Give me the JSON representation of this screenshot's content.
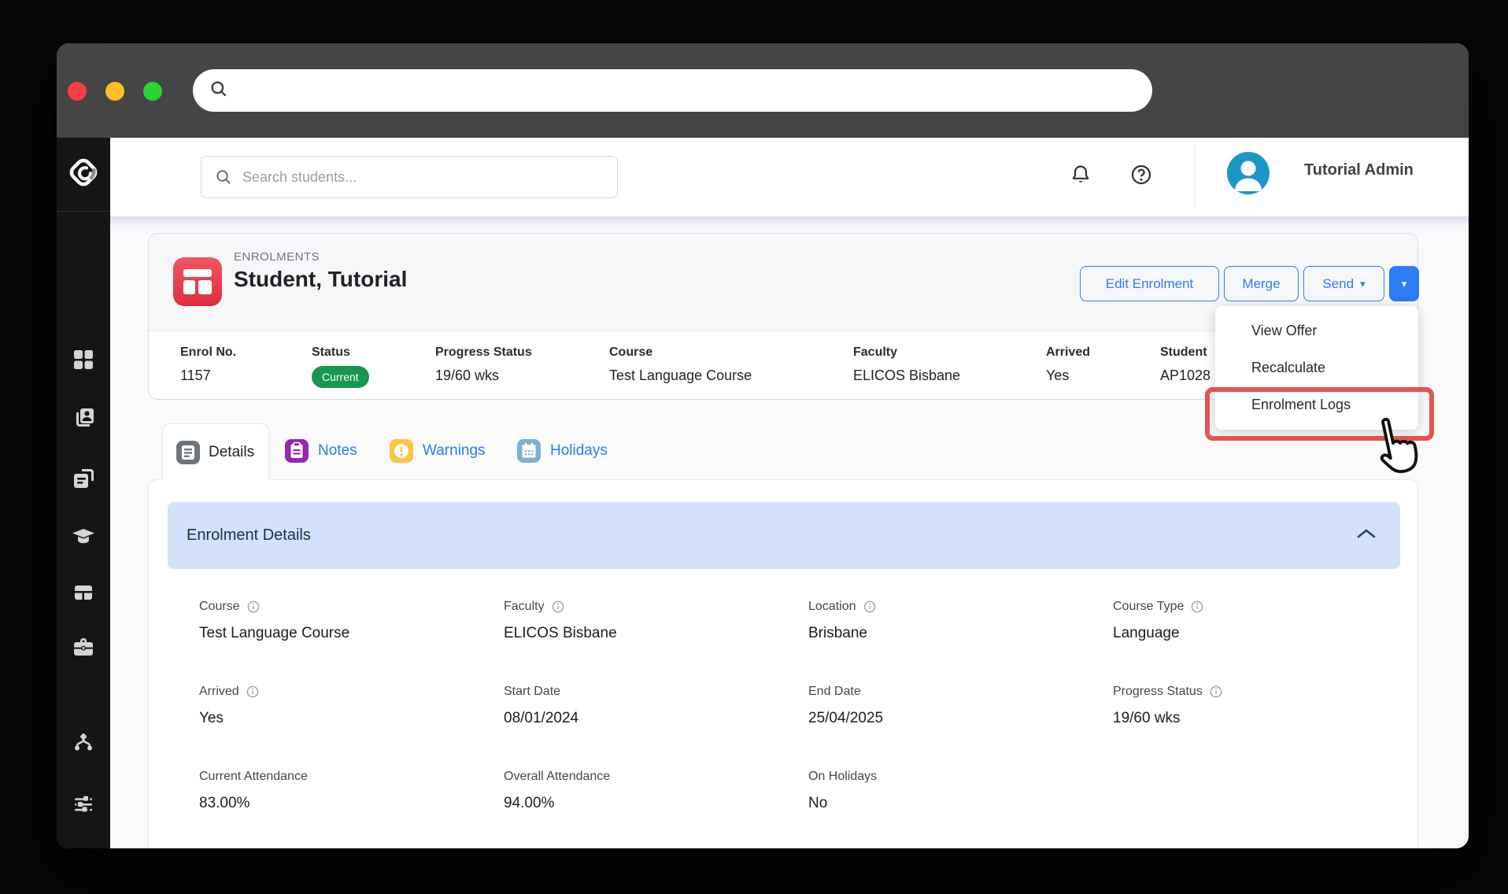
{
  "colors": {
    "accent_blue": "#2e7cf6",
    "status_green": "#16964e",
    "annotation_red": "#e4544e",
    "avatar_blue": "#1d96c5",
    "panel_header_blue": "#d3e2fa",
    "enrolments_icon_red": "#dd2e3f",
    "notes_icon_purple": "#9129b4",
    "warnings_icon_yellow": "#f8c73d",
    "holidays_icon_blue": "#7fb0d4",
    "details_icon_gray": "#6d757b"
  },
  "topbar": {
    "search_placeholder": "Search students...",
    "user_name": "Tutorial Admin",
    "icons": [
      "bell-icon",
      "help-icon",
      "avatar"
    ]
  },
  "sidebar": {
    "icons": [
      "dashboard",
      "contacts",
      "documents",
      "courses",
      "tables",
      "briefcase",
      "workflow",
      "settings"
    ]
  },
  "header": {
    "eyebrow": "ENROLMENTS",
    "title": "Student, Tutorial",
    "buttons": {
      "edit": "Edit Enrolment",
      "merge": "Merge",
      "send": "Send"
    }
  },
  "summary": {
    "columns": [
      {
        "label": "Enrol No.",
        "value": "1157"
      },
      {
        "label": "Status",
        "value": "Current",
        "type": "badge"
      },
      {
        "label": "Progress Status",
        "value": "19/60 wks"
      },
      {
        "label": "Course",
        "value": "Test Language Course"
      },
      {
        "label": "Faculty",
        "value": "ELICOS Bisbane"
      },
      {
        "label": "Arrived",
        "value": "Yes"
      },
      {
        "label": "Student",
        "value": "AP1028",
        "type": "link"
      }
    ]
  },
  "menu": {
    "items": [
      {
        "label": "View Offer"
      },
      {
        "label": "Recalculate"
      },
      {
        "label": "Enrolment Logs",
        "highlighted": true
      }
    ]
  },
  "tabs": [
    {
      "label": "Details",
      "active": true
    },
    {
      "label": "Notes"
    },
    {
      "label": "Warnings"
    },
    {
      "label": "Holidays"
    }
  ],
  "panel": {
    "title": "Enrolment Details",
    "fields": [
      {
        "label": "Course",
        "value": "Test Language Course",
        "info": true
      },
      {
        "label": "Faculty",
        "value": "ELICOS Bisbane",
        "info": true
      },
      {
        "label": "Location",
        "value": "Brisbane",
        "info": true
      },
      {
        "label": "Course Type",
        "value": "Language",
        "info": true
      },
      {
        "label": "Arrived",
        "value": "Yes",
        "info": true
      },
      {
        "label": "Start Date",
        "value": "08/01/2024"
      },
      {
        "label": "End Date",
        "value": "25/04/2025"
      },
      {
        "label": "Progress Status",
        "value": "19/60 wks",
        "info": true
      },
      {
        "label": "Current Attendance",
        "value": "83.00%"
      },
      {
        "label": "Overall Attendance",
        "value": "94.00%"
      },
      {
        "label": "On Holidays",
        "value": "No"
      }
    ]
  }
}
